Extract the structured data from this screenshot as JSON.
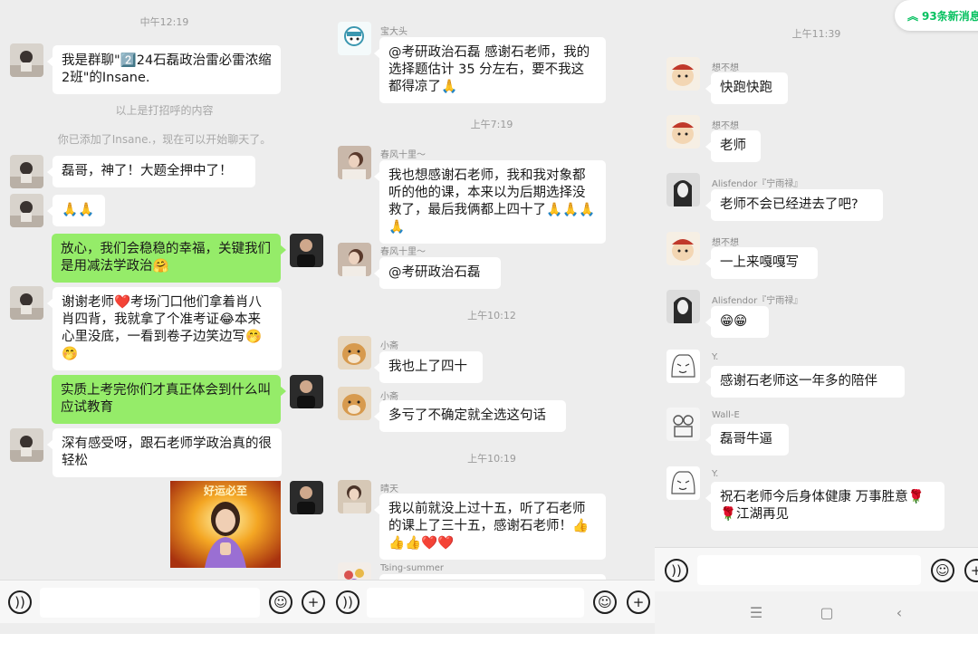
{
  "panel1": {
    "time_top": "中午12:19",
    "messages": [
      {
        "text": "我是群聊\"2️⃣24石磊政治雷必雷浓缩2班\"的Insane."
      },
      {
        "system": "以上是打招呼的内容"
      },
      {
        "system": "你已添加了Insane.，现在可以开始聊天了。"
      },
      {
        "text": "磊哥，神了！大题全押中了！"
      },
      {
        "text": "🙏🙏"
      },
      {
        "text": "放心，我们会稳稳的幸福，关键我们是用减法学政治🤗"
      },
      {
        "text": "谢谢老师❤️考场门口他们拿着肖八肖四背，我就拿了个准考证😂本来心里没底，一看到卷子边笑边写🤭🤭"
      },
      {
        "text": "实质上考完你们才真正体会到什么叫应试教育"
      },
      {
        "text": "深有感受呀，跟石老师学政治真的很轻松"
      }
    ],
    "image_caption": "好运必至"
  },
  "panel2": {
    "times": [
      "上午7:19",
      "上午10:12",
      "上午10:19"
    ],
    "messages": [
      {
        "name": "宝大头",
        "text": "@考研政治石磊  感谢石老师，我的选择题估计 35 分左右，要不我这都得凉了🙏"
      },
      {
        "name": "春风十里～",
        "text": "我也想感谢石老师，我和我对象都听的他的课，本来以为后期选择没救了，最后我俩都上四十了🙏🙏🙏🙏"
      },
      {
        "name": "春风十里～",
        "text": "@考研政治石磊"
      },
      {
        "name": "小斋",
        "text": "我也上了四十"
      },
      {
        "name": "小斋",
        "text": "多亏了不确定就全选这句话"
      },
      {
        "name": "晴天",
        "text": "我以前就没上过十五，听了石老师的课上了三十五，感谢石老师！👍👍👍❤️❤️"
      },
      {
        "name": "Tsing-summer",
        "text": ""
      }
    ]
  },
  "panel3": {
    "new_messages": "93条新消息",
    "time_top": "上午11:39",
    "messages": [
      {
        "name": "想不想",
        "text": "快跑快跑"
      },
      {
        "name": "想不想",
        "text": "老师"
      },
      {
        "name": "Alisfendor『宁雨禄』",
        "text": "老师不会已经进去了吧?"
      },
      {
        "name": "想不想",
        "text": "一上来嘎嘎写"
      },
      {
        "name": "Alisfendor『宁雨禄』",
        "text": "😁😁"
      },
      {
        "name": "Y.",
        "text": "感谢石老师这一年多的陪伴"
      },
      {
        "name": "Wall-E",
        "text": "磊哥牛逼"
      },
      {
        "name": "Y.",
        "text": "祝石老师今后身体健康 万事胜意🌹🌹江湖再见"
      }
    ]
  },
  "input_bar": {
    "voice_icon": "voice-icon",
    "emoji_icon": "emoji-icon",
    "plus_icon": "plus-icon"
  },
  "colors": {
    "chat_bg": "#ededed",
    "self_bubble": "#95ec69",
    "other_bubble": "#ffffff",
    "accent": "#07c160"
  }
}
